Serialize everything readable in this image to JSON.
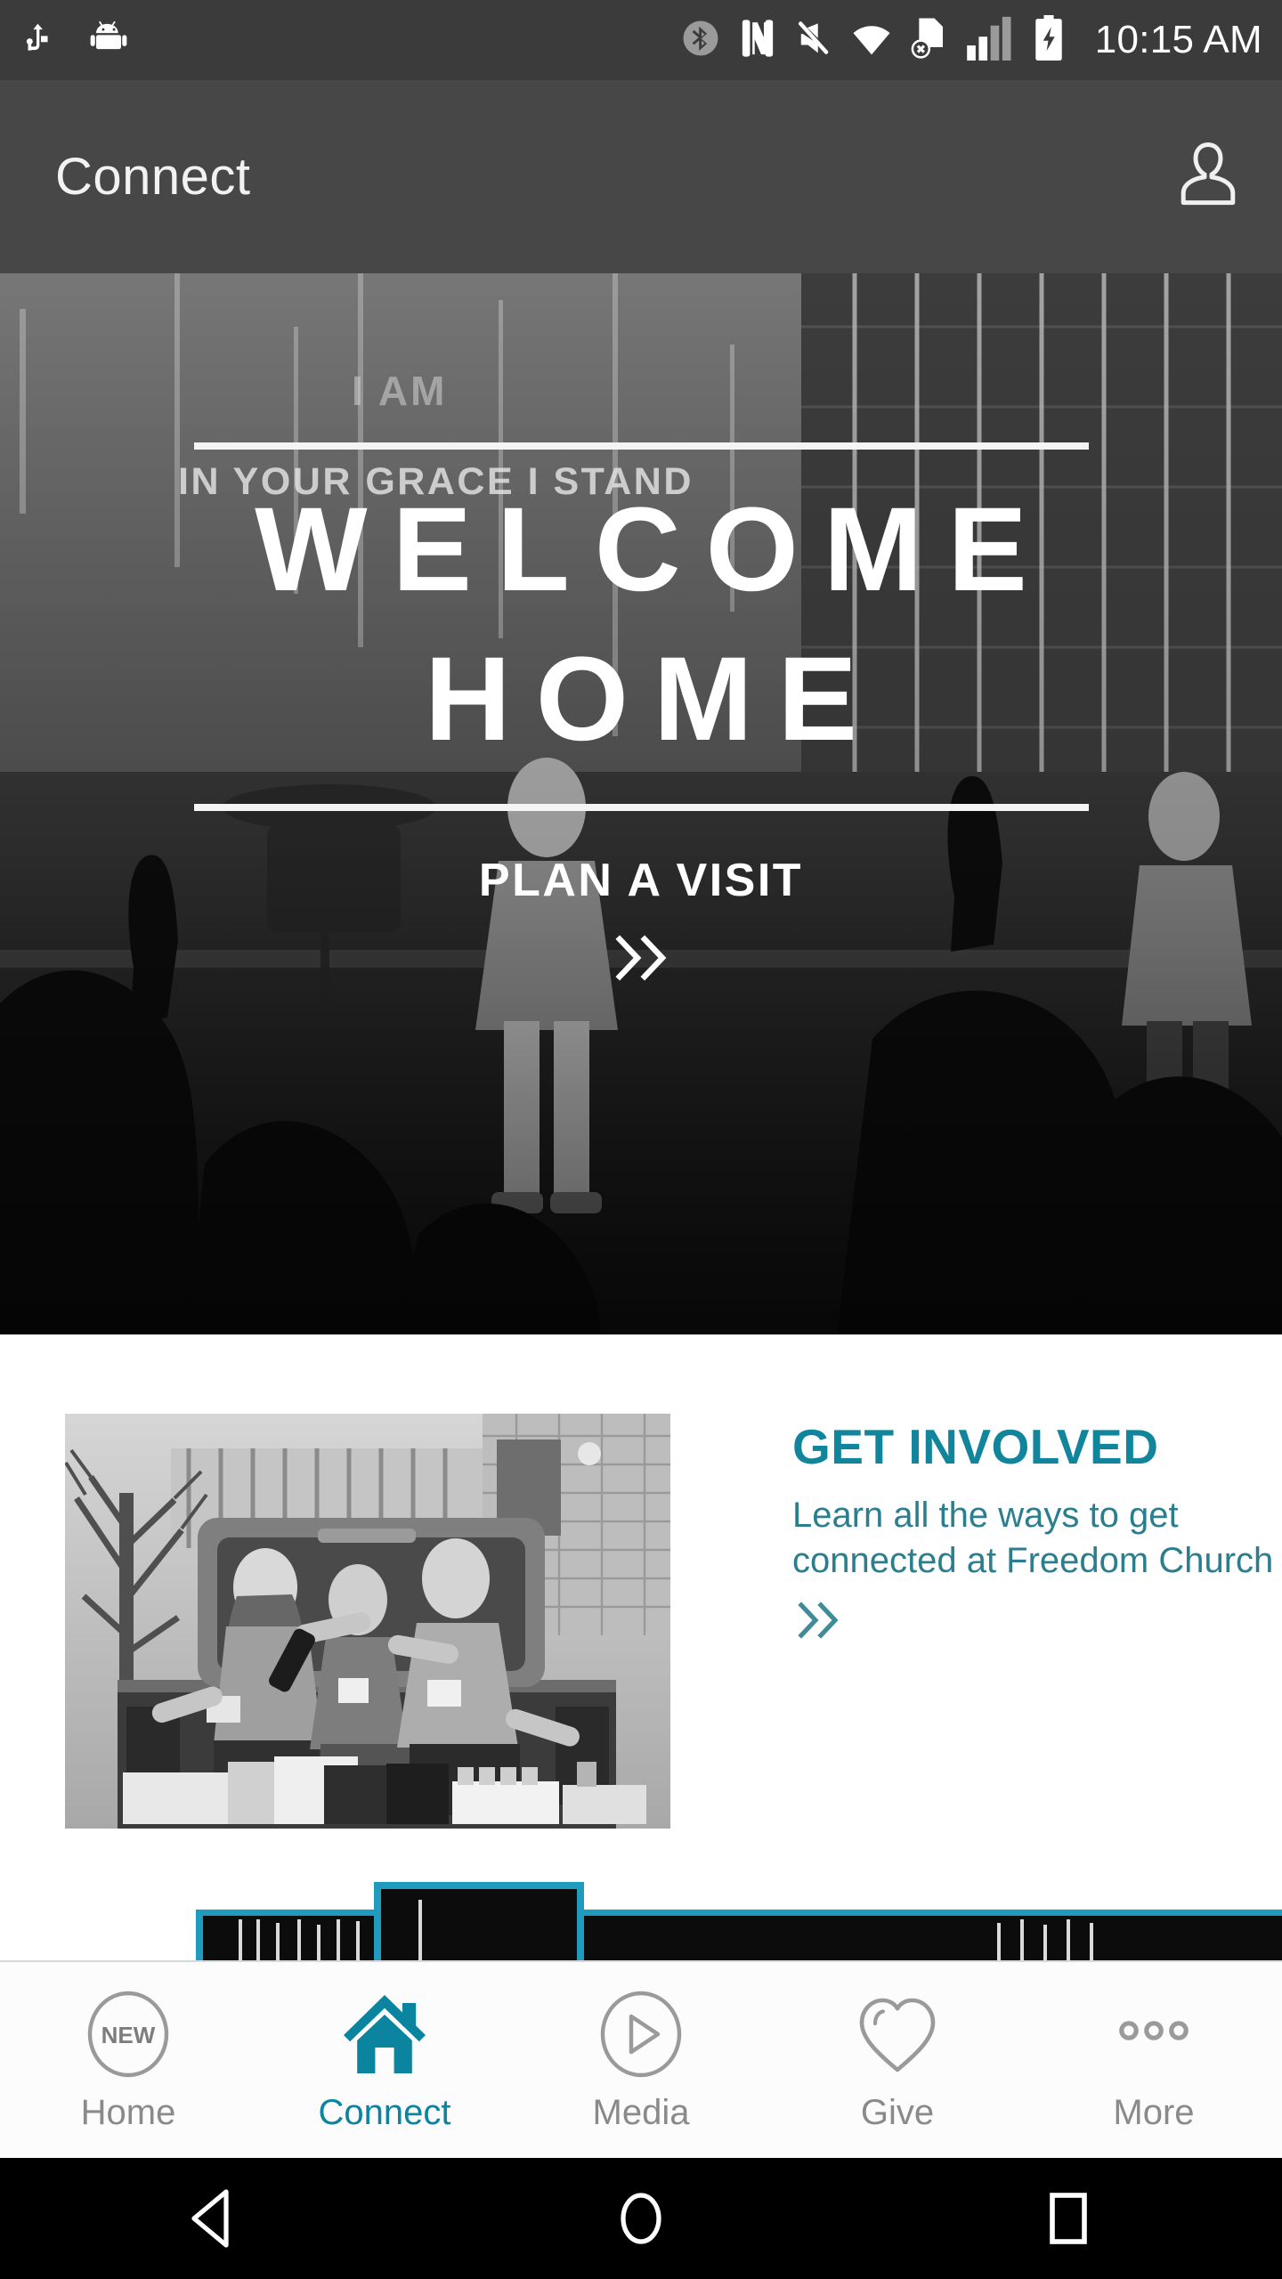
{
  "status_bar": {
    "time": "10:15 AM",
    "left_icons": [
      "usb-icon",
      "android-debug-icon"
    ],
    "right_icons": [
      "bluetooth-icon",
      "nfc-icon",
      "mute-icon",
      "wifi-icon",
      "no-sim-icon",
      "signal-bars-icon",
      "battery-charging-icon"
    ],
    "background": "#3b3b3b"
  },
  "app_bar": {
    "title": "Connect",
    "profile_icon": "person-icon",
    "background": "#474747"
  },
  "hero": {
    "projection_text": "IN YOUR GRACE I STAND",
    "line1": "WELCOME",
    "line2": "HOME",
    "cta": "PLAN A VISIT",
    "chevron": "double-chevron-right-icon",
    "alt": "Worship band and congregation on stage, grayscale"
  },
  "content": {
    "get_involved": {
      "title": "GET INVOLVED",
      "subtitle": "Learn all the ways to get connected at Freedom Church",
      "chevron": "double-chevron-right-icon",
      "title_color": "#10859c",
      "subtitle_color": "#2b7e8e",
      "photo_alt": "Three volunteers sitting in a pickup truck bed with boxes of donated food, grayscale"
    },
    "next_card": {
      "alt": "Partially visible card showing a teal-outlined stage building graphic"
    }
  },
  "tabs": [
    {
      "label": "Home",
      "icon": "new-badge-circle-icon",
      "active": false
    },
    {
      "label": "Connect",
      "icon": "home-house-icon",
      "active": true
    },
    {
      "label": "Media",
      "icon": "play-circle-icon",
      "active": false
    },
    {
      "label": "Give",
      "icon": "heart-outline-icon",
      "active": false
    },
    {
      "label": "More",
      "icon": "three-dots-icon",
      "active": false
    }
  ],
  "tab_bar": {
    "active_color": "#0b84a0",
    "inactive_color": "#8a8a8a",
    "new_badge_text": "NEW"
  },
  "android_nav": {
    "back": "back-triangle-icon",
    "home": "home-circle-icon",
    "recents": "recents-square-icon"
  }
}
